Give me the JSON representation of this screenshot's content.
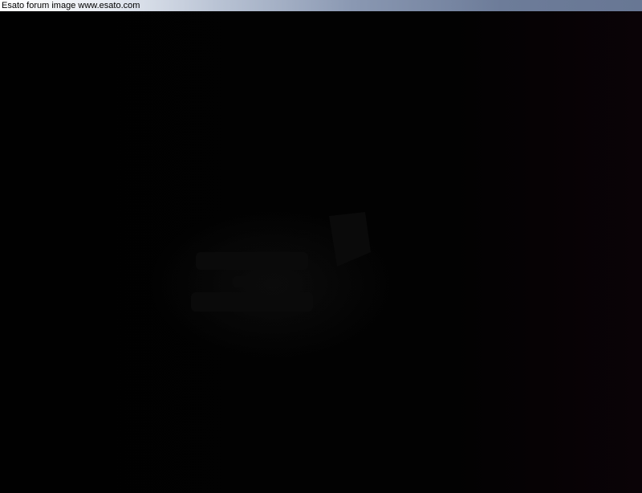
{
  "caption": {
    "text": "Esato forum image www.esato.com"
  },
  "colors": {
    "background": "#020202",
    "caption_bar_start": "#ffffff",
    "caption_bar_end": "#687794"
  }
}
